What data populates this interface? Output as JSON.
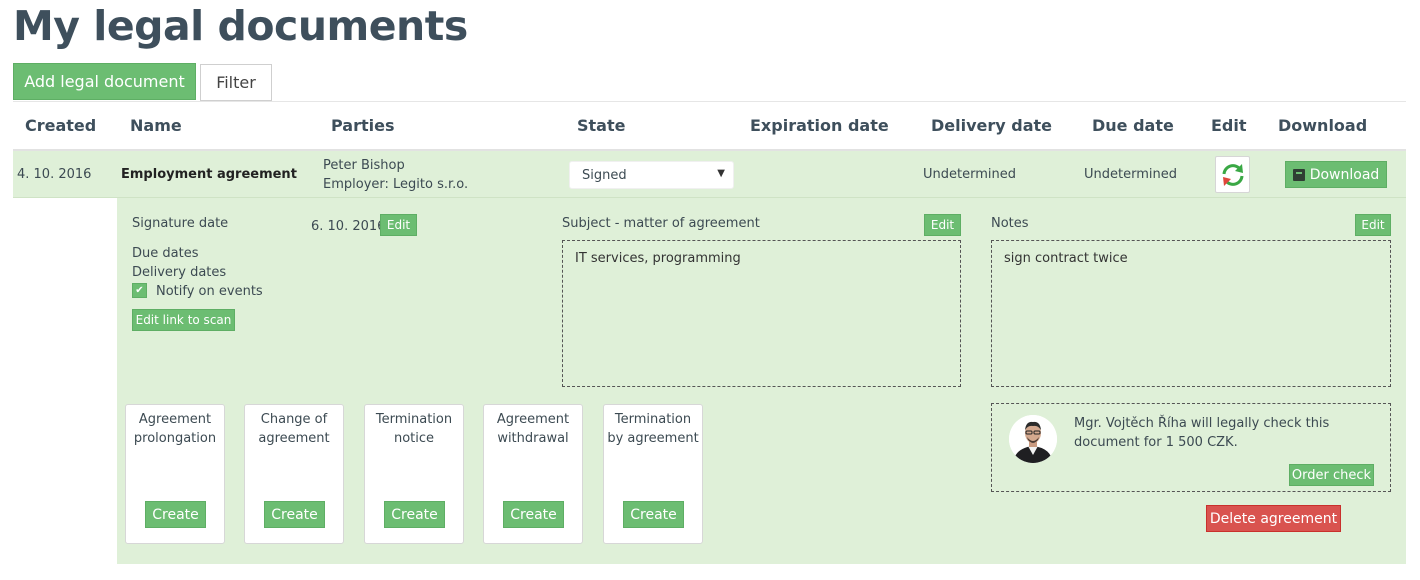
{
  "page": {
    "title": "My legal documents"
  },
  "toolbar": {
    "add_label": "Add legal document",
    "filter_label": "Filter"
  },
  "table": {
    "headers": [
      "Created",
      "Name",
      "Parties",
      "State",
      "Expiration date",
      "Delivery date",
      "Due date",
      "Edit",
      "Download"
    ],
    "row": {
      "created": "4. 10. 2016",
      "name": "Employment agreement",
      "parties": [
        "Peter Bishop",
        "Employer: Legito s.r.o."
      ],
      "state": "Signed",
      "expiration_date": "",
      "delivery_date": "Undetermined",
      "due_date": "Undetermined",
      "download_label": "Download"
    }
  },
  "detail": {
    "signature_date_label": "Signature date",
    "signature_date_value": "6. 10. 2016",
    "edit_label": "Edit",
    "due_dates_label": "Due dates",
    "delivery_dates_label": "Delivery dates",
    "notify_label": "Notify on events",
    "notify_checked": true,
    "edit_link_label": "Edit link to scan",
    "subject_label": "Subject - matter of agreement",
    "subject_value": "IT services, programming",
    "notes_label": "Notes",
    "notes_value": "sign contract twice"
  },
  "actions": [
    {
      "title": "Agreement\nprolongation",
      "button": "Create"
    },
    {
      "title": "Change of\nagreement",
      "button": "Create"
    },
    {
      "title": "Termination\nnotice",
      "button": "Create"
    },
    {
      "title": "Agreement\nwithdrawal",
      "button": "Create"
    },
    {
      "title": "Termination\nby agreement",
      "button": "Create"
    }
  ],
  "lawyer": {
    "text": "Mgr. Vojtěch Říha will legally check this document for 1 500 CZK.",
    "order_label": "Order check"
  },
  "delete_label": "Delete agreement",
  "colors": {
    "accent": "#6cbd72",
    "row_bg": "#dff0d8",
    "danger": "#d9534f",
    "title": "#3e4f5c"
  }
}
